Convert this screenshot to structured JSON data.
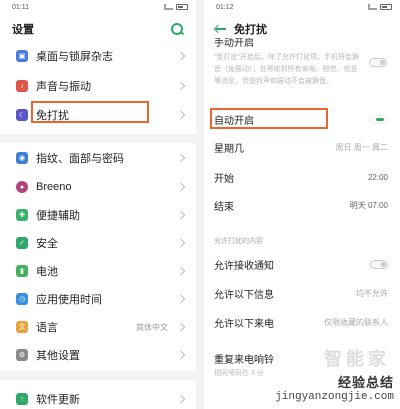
{
  "left": {
    "status": {
      "time": "01:11"
    },
    "title": "设置",
    "items": [
      {
        "label": "桌面与锁屏杂志",
        "color": "#4a7bd8",
        "value": ""
      },
      {
        "label": "声音与振动",
        "color": "#e0554a",
        "value": ""
      },
      {
        "label": "免打扰",
        "color": "#5a55c9",
        "value": ""
      },
      {
        "label": "指纹、面部与密码",
        "color": "#3f7fd6",
        "value": ""
      },
      {
        "label": "Breeno",
        "color": "#b0457a",
        "value": ""
      },
      {
        "label": "便捷辅助",
        "color": "#38b36d",
        "value": ""
      },
      {
        "label": "安全",
        "color": "#2fa86a",
        "value": ""
      },
      {
        "label": "电池",
        "color": "#44b25a",
        "value": ""
      },
      {
        "label": "应用使用时间",
        "color": "#3b8fe0",
        "value": ""
      },
      {
        "label": "语言",
        "color": "#e8a23a",
        "value": "简体中文"
      },
      {
        "label": "其他设置",
        "color": "#8a8a8a",
        "value": ""
      },
      {
        "label": "软件更新",
        "color": "#2fa86a",
        "value": ""
      }
    ]
  },
  "right": {
    "status": {
      "time": "01:12"
    },
    "title": "免打扰",
    "manual_label": "手动开启",
    "manual_desc": "\"免打扰\"开启后，除了允许打扰项，手机将会静音（免振动），且将收到所有来电、短信、信息等消息，但是铃声和振动不会被静音。",
    "auto_label": "自动开启",
    "weekday_label": "星期几",
    "weekday_value": "周日 周一 周二",
    "start_label": "开始",
    "start_value": "22:00",
    "end_label": "结束",
    "end_value": "明天 07:00",
    "section_label": "允许打扰的内容",
    "notify_label": "允许接收通知",
    "info_label": "允许以下信息",
    "info_value": "均不允许",
    "call_label": "允许以下来电",
    "call_value": "仅限收藏的联系人",
    "repeat_label": "重复来电响铃",
    "repeat_desc": "相同号码在 3 分"
  },
  "watermark": {
    "brand": "经验总结",
    "url": "jingyanzongjie.com",
    "gray": "智能家"
  },
  "colors": {
    "accent": "#2fa86a",
    "highlight": "#e8672d"
  }
}
